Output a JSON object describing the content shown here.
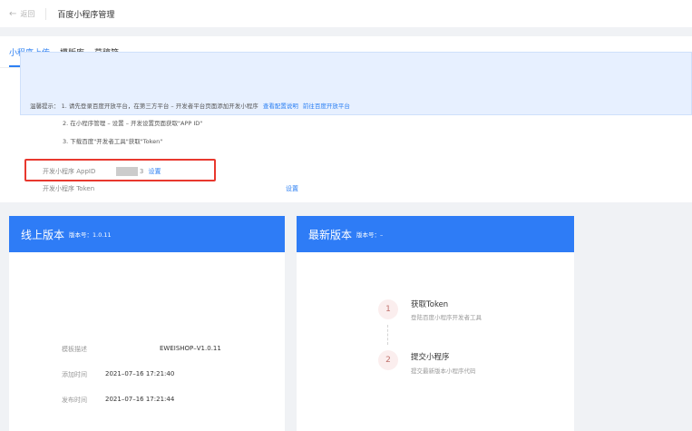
{
  "topbar": {
    "back_label": "返回",
    "title": "百度小程序管理"
  },
  "tabs": [
    {
      "label": "小程序上传",
      "active": true
    },
    {
      "label": "模版库",
      "active": false
    },
    {
      "label": "草稿箱",
      "active": false
    }
  ],
  "tips": {
    "prefix": "温馨提示：",
    "line1": "1. 请先登录百度开放平台，在第三方平台 – 开发者平台页面添加开发小程序",
    "link_guide": "查看配置说明",
    "link_platform": "前往百度开放平台",
    "line2": "2. 在小程序管理 – 设置 – 开发设置页面获取\"APP ID\"",
    "line3": "3. 下载百度\"开发者工具\"获取\"Token\""
  },
  "config": {
    "appid_label": "开发小程序 AppID",
    "appid_suffix": "3",
    "appid_set": "设置",
    "token_label": "开发小程序 Token",
    "token_set": "设置"
  },
  "online": {
    "title": "线上版本",
    "version_label": "版本号：1.0.11",
    "rows": [
      {
        "label": "模板描述",
        "value": "EWEISHOP–V1.0.11"
      },
      {
        "label": "添加时间",
        "value": "2021–07–16 17:21:40"
      },
      {
        "label": "发布时间",
        "value": "2021–07–16 17:21:44"
      }
    ]
  },
  "latest": {
    "title": "最新版本",
    "version_label": "版本号：–",
    "steps": [
      {
        "num": "1",
        "title": "获取Token",
        "desc": "登陆百度小程序开发者工具"
      },
      {
        "num": "2",
        "title": "提交小程序",
        "desc": "提交最新版本小程序代码"
      }
    ]
  },
  "colors": {
    "accent": "#2e7cf6",
    "highlight": "#e8382e",
    "tip_bg": "#e7f0ff"
  }
}
